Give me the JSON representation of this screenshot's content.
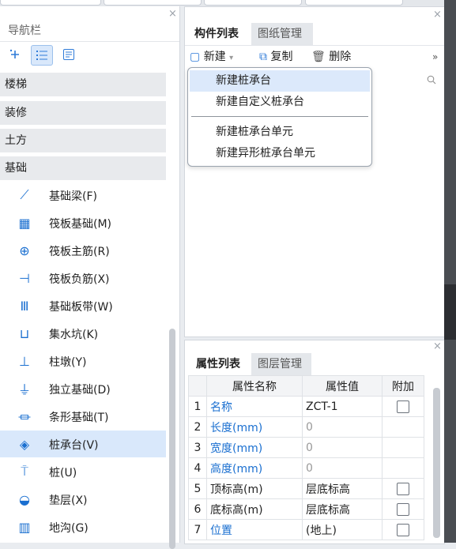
{
  "nav": {
    "title": "导航栏",
    "close": "×",
    "categories": [
      "楼梯",
      "装修",
      "土方",
      "基础"
    ],
    "items": [
      {
        "label": "基础梁(F)",
        "icon": "beam-icon",
        "glyph": "⟋"
      },
      {
        "label": "筏板基础(M)",
        "icon": "grid-slab-icon",
        "glyph": "▦"
      },
      {
        "label": "筏板主筋(R)",
        "icon": "main-rebar-icon",
        "glyph": "⊕"
      },
      {
        "label": "筏板负筋(X)",
        "icon": "neg-rebar-icon",
        "glyph": "⊣"
      },
      {
        "label": "基础板带(W)",
        "icon": "slab-strip-icon",
        "glyph": "Ⅲ"
      },
      {
        "label": "集水坑(K)",
        "icon": "sump-icon",
        "glyph": "⊔"
      },
      {
        "label": "柱墩(Y)",
        "icon": "column-pier-icon",
        "glyph": "⊥"
      },
      {
        "label": "独立基础(D)",
        "icon": "isolated-footing-icon",
        "glyph": "⏚"
      },
      {
        "label": "条形基础(T)",
        "icon": "strip-footing-icon",
        "glyph": "⏛"
      },
      {
        "label": "桩承台(V)",
        "icon": "pile-cap-icon",
        "glyph": "◈",
        "selected": true
      },
      {
        "label": "桩(U)",
        "icon": "pile-icon",
        "glyph": "⍑"
      },
      {
        "label": "垫层(X)",
        "icon": "cushion-icon",
        "glyph": "◒"
      },
      {
        "label": "地沟(G)",
        "icon": "trench-icon",
        "glyph": "▥"
      }
    ]
  },
  "component_panel": {
    "tabs": [
      "构件列表",
      "图纸管理"
    ],
    "close": "×",
    "toolbar": {
      "new": "新建",
      "copy": "复制",
      "delete": "删除",
      "more": "»"
    },
    "dropdown": [
      "新建桩承台",
      "新建自定义桩承台",
      "新建桩承台单元",
      "新建异形桩承台单元"
    ]
  },
  "props_panel": {
    "tabs": [
      "属性列表",
      "图层管理"
    ],
    "close": "×",
    "headers": [
      "属性名称",
      "属性值",
      "附加"
    ],
    "rows": [
      {
        "num": "1",
        "name": "名称",
        "value": "ZCT-1",
        "check": true
      },
      {
        "num": "2",
        "name": "长度(mm)",
        "value": "0",
        "check": false
      },
      {
        "num": "3",
        "name": "宽度(mm)",
        "value": "0",
        "check": false
      },
      {
        "num": "4",
        "name": "高度(mm)",
        "value": "0",
        "check": false
      },
      {
        "num": "5",
        "name": "顶标高(m)",
        "value": "层底标高",
        "check": true
      },
      {
        "num": "6",
        "name": "底标高(m)",
        "value": "层底标高",
        "check": true
      },
      {
        "num": "7",
        "name": "位置",
        "value": "(地上)",
        "check": true
      }
    ]
  },
  "colors": {
    "accent": "#1a6fd0",
    "selected_bg": "#d9e8fb",
    "category_bg": "#e8eaed"
  }
}
